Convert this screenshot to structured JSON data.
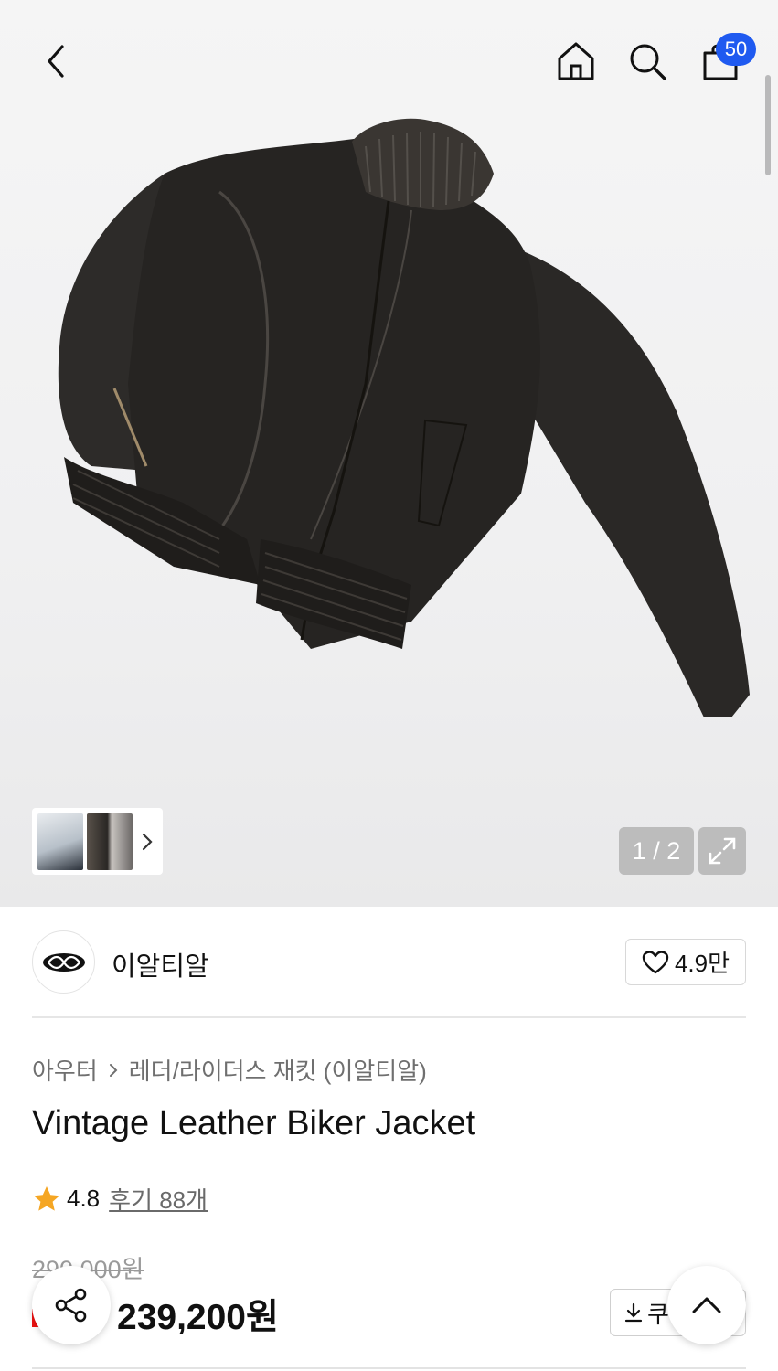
{
  "header": {
    "back_icon": "chevron-left-icon",
    "home_icon": "home-icon",
    "search_icon": "search-icon",
    "cart_icon": "shopping-bag-icon",
    "cart_count": "50",
    "badge_color": "#1f5af0"
  },
  "gallery": {
    "counter": "1 / 2",
    "expand_icon": "expand-icon",
    "thumbs_next_icon": "chevron-right-icon"
  },
  "brand": {
    "name": "이알티알",
    "like_icon": "heart-icon",
    "like_count": "4.9만"
  },
  "breadcrumb": {
    "items": [
      "아우터",
      "레더/라이더스 재킷 (이알티알)"
    ],
    "separator_icon": "chevron-right-icon"
  },
  "product": {
    "title": "Vintage Leather Biker Jacket",
    "rating": "4.8",
    "reviews_label": "후기 88개",
    "original_price": "290,000원",
    "sale_price": "239,200원",
    "coupon_label": "쿠",
    "star_color": "#f5a623",
    "discount_color": "#e11111"
  },
  "fabs": {
    "share_icon": "share-icon",
    "top_icon": "chevron-up-icon"
  }
}
